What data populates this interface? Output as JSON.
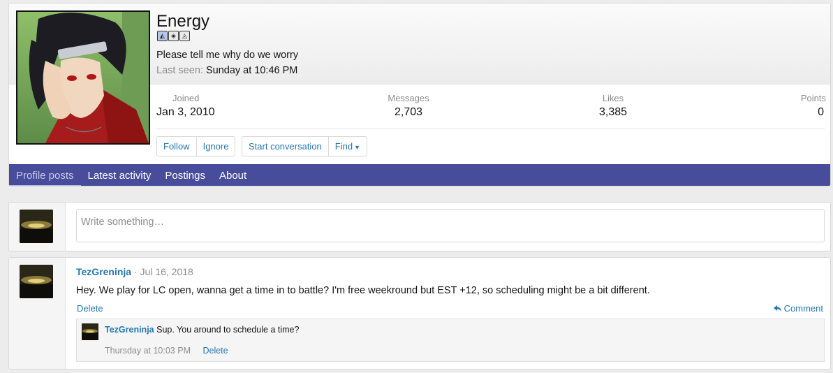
{
  "profile": {
    "username": "Energy",
    "custom_title": "Please tell me why do we worry",
    "last_seen_label": "Last seen:",
    "last_seen_value": "Sunday at 10:46 PM",
    "badges": [
      {
        "icon": "badge-icon-1"
      },
      {
        "icon": "badge-icon-2"
      },
      {
        "icon": "badge-icon-3"
      }
    ],
    "stats": {
      "joined_label": "Joined",
      "joined_value": "Jan 3, 2010",
      "messages_label": "Messages",
      "messages_value": "2,703",
      "likes_label": "Likes",
      "likes_value": "3,385",
      "points_label": "Points",
      "points_value": "0"
    },
    "actions": {
      "follow": "Follow",
      "ignore": "Ignore",
      "start_conversation": "Start conversation",
      "find": "Find"
    }
  },
  "tabs": [
    {
      "label": "Profile posts",
      "active": true
    },
    {
      "label": "Latest activity",
      "active": false
    },
    {
      "label": "Postings",
      "active": false
    },
    {
      "label": "About",
      "active": false
    }
  ],
  "composer": {
    "placeholder": "Write something…"
  },
  "post": {
    "author": "TezGreninja",
    "separator": "·",
    "date": "Jul 16, 2018",
    "body": "Hey. We play for LC open, wanna get a time in to battle? I'm free weekround but EST +12, so scheduling might be a bit different.",
    "delete_label": "Delete",
    "comment_label": "Comment",
    "comment": {
      "author": "TezGreninja",
      "text": "Sup. You around to schedule a time?",
      "date": "Thursday at 10:03 PM",
      "delete_label": "Delete"
    }
  },
  "colors": {
    "link": "#2577b1",
    "tab_bar": "#474c9b",
    "muted": "#8c8c8c"
  }
}
